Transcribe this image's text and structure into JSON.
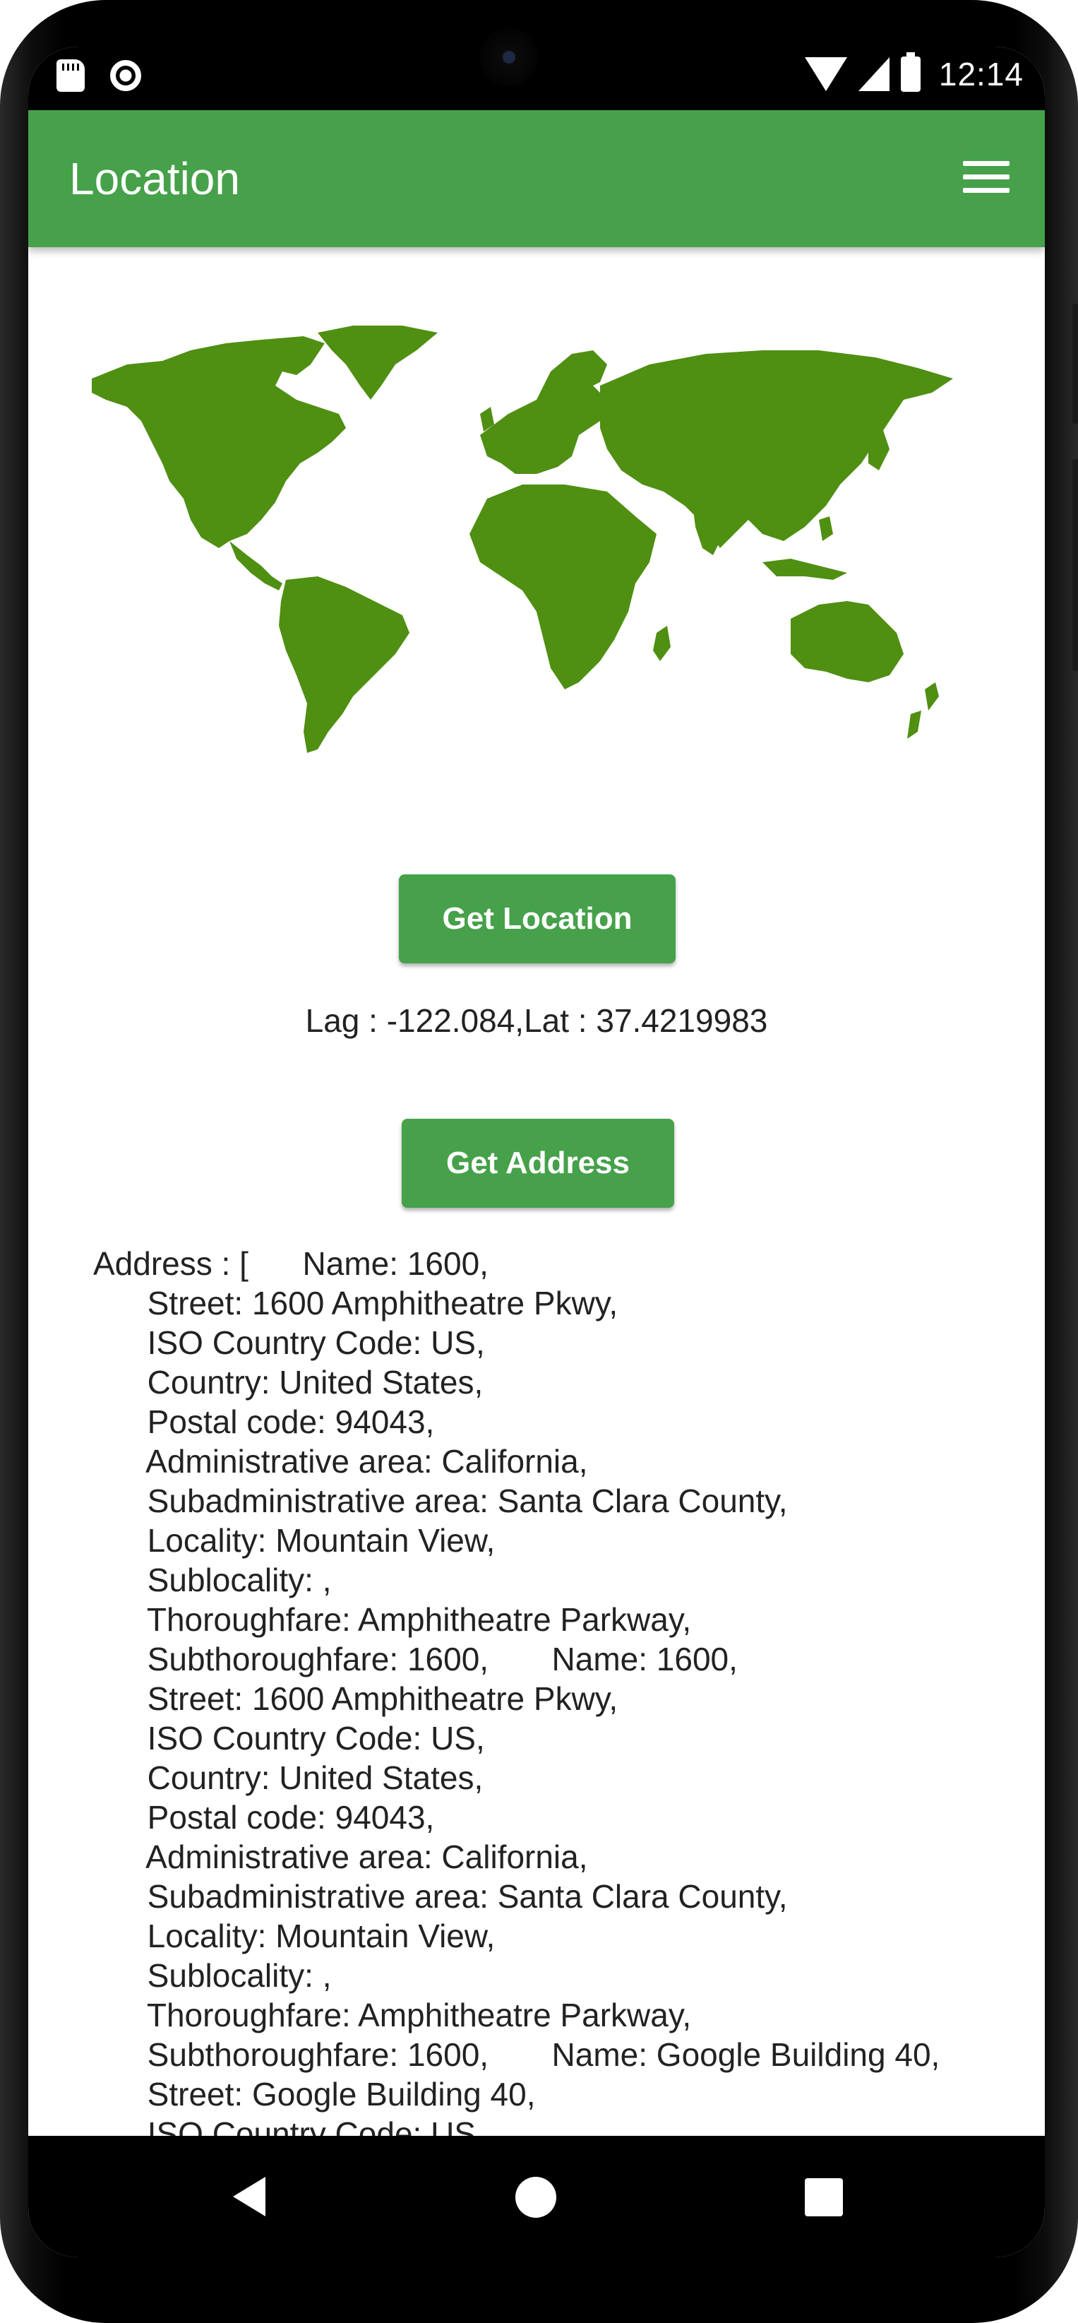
{
  "status_bar": {
    "time": "12:14"
  },
  "app_bar": {
    "title": "Location"
  },
  "map": {
    "color": "#4f8f12"
  },
  "buttons": {
    "get_location": "Get Location",
    "get_address": "Get Address"
  },
  "coords_text": "Lag : -122.084,Lat : 37.4219983",
  "address_lines": [
    "Address : [      Name: 1600,",
    "      Street: 1600 Amphitheatre Pkwy,",
    "      ISO Country Code: US,",
    "      Country: United States,",
    "      Postal code: 94043,",
    "      Administrative area: California,",
    "      Subadministrative area: Santa Clara County,",
    "      Locality: Mountain View,",
    "      Sublocality: ,",
    "      Thoroughfare: Amphitheatre Parkway,",
    "      Subthoroughfare: 1600,       Name: 1600,",
    "      Street: 1600 Amphitheatre Pkwy,",
    "      ISO Country Code: US,",
    "      Country: United States,",
    "      Postal code: 94043,",
    "      Administrative area: California,",
    "      Subadministrative area: Santa Clara County,",
    "      Locality: Mountain View,",
    "      Sublocality: ,",
    "      Thoroughfare: Amphitheatre Parkway,",
    "      Subthoroughfare: 1600,       Name: Google Building 40,",
    "      Street: Google Building 40,",
    "      ISO Country Code: US,"
  ],
  "colors": {
    "primary": "#46a14a",
    "map_green": "#4f8f12"
  }
}
